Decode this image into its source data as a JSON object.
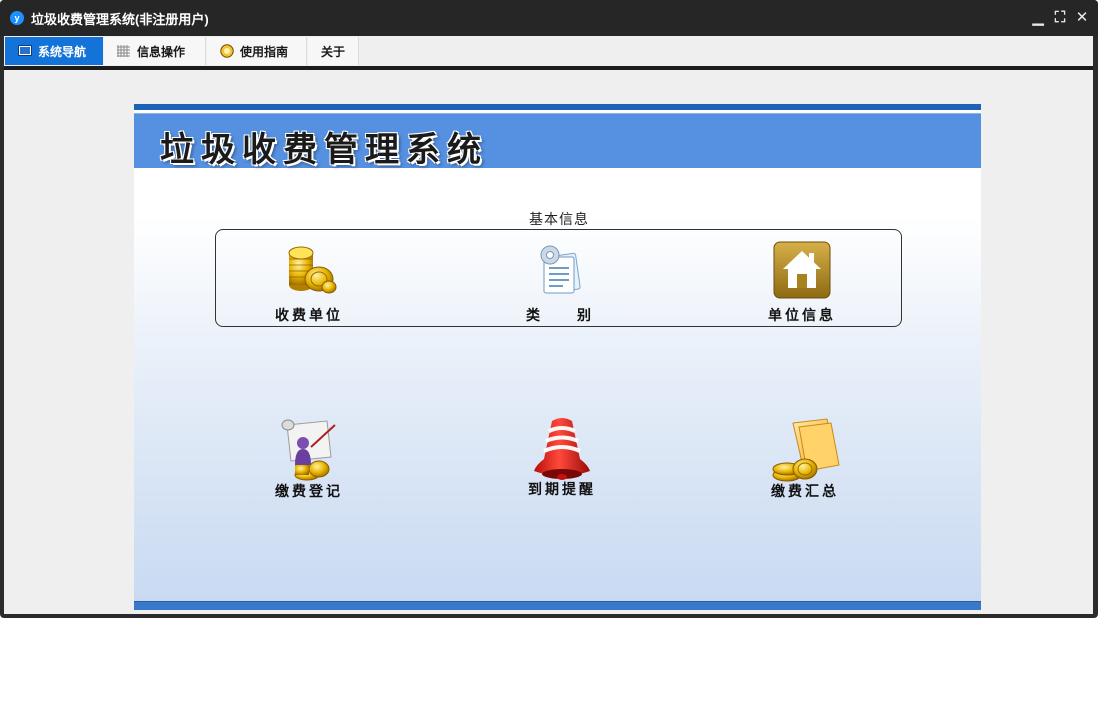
{
  "window": {
    "title": "垃圾收费管理系统(非注册用户)",
    "logo_letter": "y",
    "controls": {
      "minimize": "▁",
      "restore": "⛶",
      "close": "✕"
    }
  },
  "menu": {
    "items": [
      {
        "label": "系统导航",
        "icon": "monitor-icon",
        "active": true
      },
      {
        "label": "信息操作",
        "icon": "grid-icon",
        "active": false
      },
      {
        "label": "使用指南",
        "icon": "help-icon",
        "active": false
      },
      {
        "label": "关于",
        "icon": "",
        "active": false
      }
    ]
  },
  "banner": {
    "title": "垃圾收费管理系统"
  },
  "section": {
    "label": "基本信息"
  },
  "tiles": {
    "fee_unit": {
      "label": "收费单位",
      "icon": "gold-coins-icon"
    },
    "category": {
      "label": "类　　别",
      "icon": "settings-document-icon"
    },
    "unit_info": {
      "label": "单位信息",
      "icon": "house-icon"
    },
    "payment_register": {
      "label": "缴费登记",
      "icon": "scroll-person-icon"
    },
    "expiry_reminder": {
      "label": "到期提醒",
      "icon": "bell-icon"
    },
    "payment_summary": {
      "label": "缴费汇总",
      "icon": "folder-coins-icon"
    }
  },
  "colors": {
    "accent": "#1473d9",
    "banner": "#5590e1",
    "titlebar": "#262626"
  }
}
